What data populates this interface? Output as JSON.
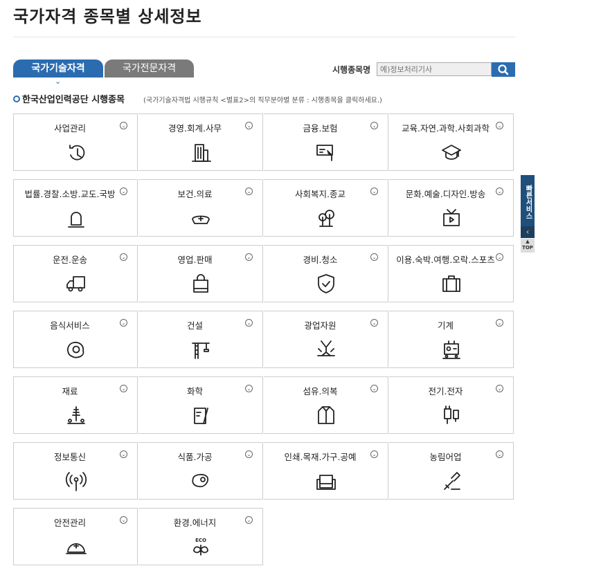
{
  "page_title": "국가자격 종목별 상세정보",
  "tabs": [
    {
      "label": "국가기술자격"
    },
    {
      "label": "국가전문자격"
    }
  ],
  "search": {
    "label": "시행종목명",
    "placeholder": "예)정보처리기사"
  },
  "section": {
    "title": "한국산업인력공단 시행종목",
    "note": "(국가기술자격법 시행규칙 <별표2>의 직무분야별 분류 : 시행종목을 클릭하세요.)"
  },
  "categories": [
    {
      "label": "사업관리",
      "icon": "clock-icon"
    },
    {
      "label": "경영.회계.사무",
      "icon": "building-icon"
    },
    {
      "label": "금융.보험",
      "icon": "card-hand-icon"
    },
    {
      "label": "교육.자연.과학.사회과학",
      "icon": "graduation-cap-icon"
    },
    {
      "label": "법률.경찰.소방.교도.국방",
      "icon": "siren-icon"
    },
    {
      "label": "보건.의료",
      "icon": "nurse-cap-icon"
    },
    {
      "label": "사회복지.종교",
      "icon": "trees-icon"
    },
    {
      "label": "문화.예술.디자인.방송",
      "icon": "tv-icon"
    },
    {
      "label": "운전.운송",
      "icon": "truck-icon"
    },
    {
      "label": "영업.판매",
      "icon": "shopping-bag-icon"
    },
    {
      "label": "경비.청소",
      "icon": "shield-check-icon"
    },
    {
      "label": "이용.숙박.여행.오락.스포츠",
      "icon": "suitcase-icon"
    },
    {
      "label": "음식서비스",
      "icon": "fried-egg-icon"
    },
    {
      "label": "건설",
      "icon": "crane-icon"
    },
    {
      "label": "광업자원",
      "icon": "mining-icon"
    },
    {
      "label": "기계",
      "icon": "robot-machine-icon"
    },
    {
      "label": "재료",
      "icon": "materials-icon"
    },
    {
      "label": "화학",
      "icon": "beaker-icon"
    },
    {
      "label": "섬유.의복",
      "icon": "jacket-icon"
    },
    {
      "label": "전기.전자",
      "icon": "plug-icon"
    },
    {
      "label": "정보통신",
      "icon": "antenna-icon"
    },
    {
      "label": "식품.가공",
      "icon": "meat-icon"
    },
    {
      "label": "인쇄.목재.가구.공예",
      "icon": "sofa-icon"
    },
    {
      "label": "농림어업",
      "icon": "shovel-icon"
    },
    {
      "label": "안전관리",
      "icon": "helmet-icon"
    },
    {
      "label": "환경.에너지",
      "icon": "eco-icon"
    }
  ],
  "eco_text": "ECO",
  "quick_service": "빠른서비스",
  "top_label": "TOP",
  "colors": {
    "accent": "#2b6cb0",
    "tab_inactive": "#7a7a7a",
    "quick": "#1f4f7a"
  }
}
